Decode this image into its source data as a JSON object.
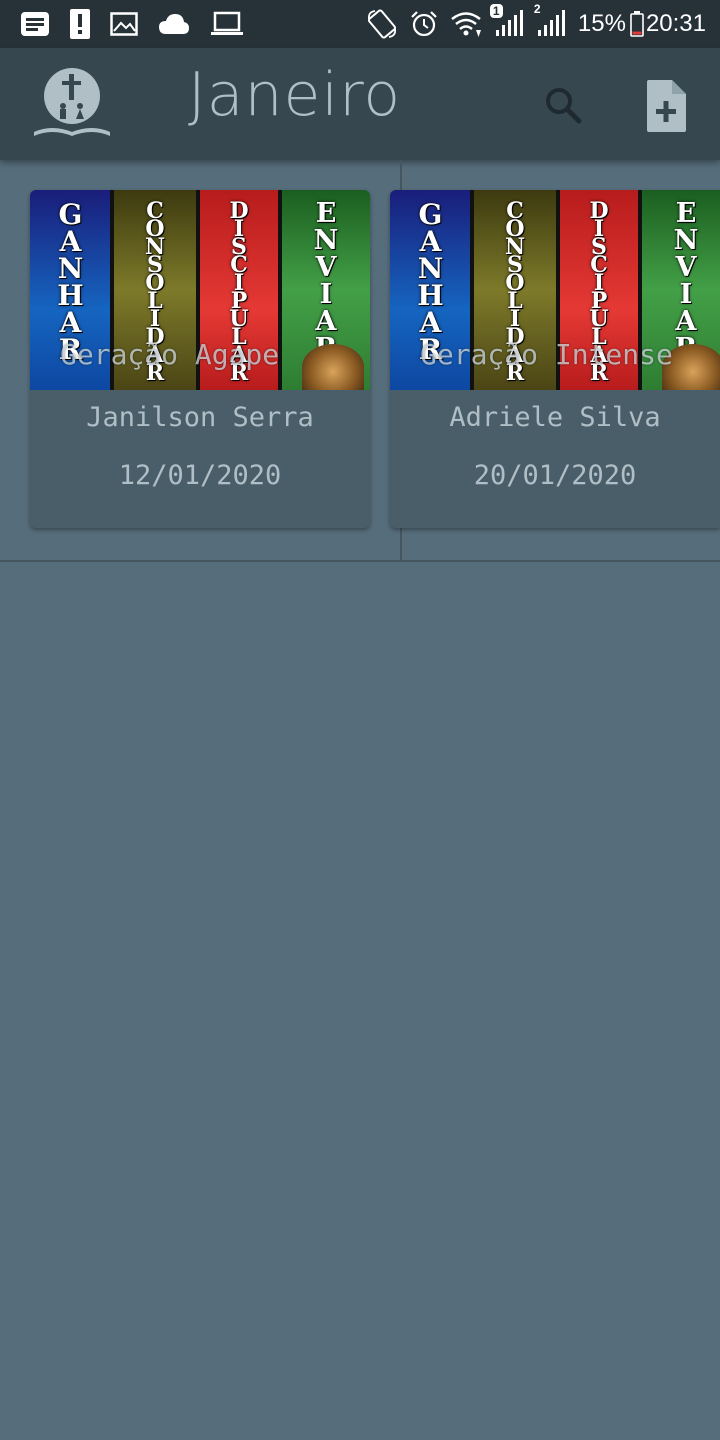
{
  "status_bar": {
    "left_icons": [
      "notes-icon",
      "alert-icon",
      "image-icon",
      "cloud-icon",
      "laptop-icon"
    ],
    "right_icons": [
      "rotate-icon",
      "alarm-icon",
      "wifi-icon",
      "signal-sim1-icon",
      "signal-sim2-icon",
      "battery-icon"
    ],
    "sim1_badge": "1",
    "sim2_badge": "2",
    "battery_percent": "15%",
    "time": "20:31",
    "battery_level": 0.15,
    "battery_low_color": "#e53935"
  },
  "app_bar": {
    "title": "Janeiro",
    "logo_icon": "church-logo-icon",
    "search_icon": "search-icon",
    "add_icon": "add-file-icon",
    "background": "#37474f",
    "title_color": "#b0bec5"
  },
  "cards": [
    {
      "banner_words": [
        "GANHAR",
        "CONSOLIDAR",
        "DISCIPULAR",
        "ENVIAR"
      ],
      "overlay": "Geração Agape",
      "name": "Janilson Serra",
      "date": "12/01/2020"
    },
    {
      "banner_words": [
        "GANHAR",
        "CONSOLIDAR",
        "DISCIPULAR",
        "ENVIAR"
      ],
      "overlay": "Geração Intense",
      "name": "Adriele Silva",
      "date": "20/01/2020"
    }
  ],
  "colors": {
    "page_background": "#566d7b",
    "card_background": "#4a5e6a",
    "status_bar": "#263238"
  }
}
